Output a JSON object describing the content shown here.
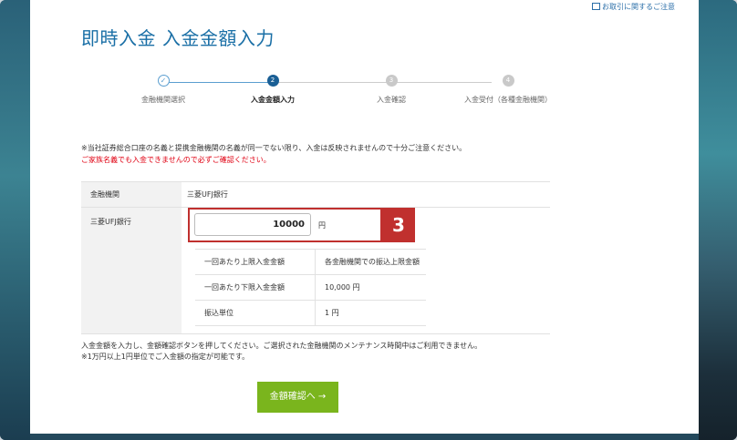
{
  "header": {
    "notice_link": "お取引に関するご注意",
    "title": "即時入金 入金金額入力"
  },
  "steps": [
    {
      "num": "✓",
      "label": "金融機関選択"
    },
    {
      "num": "2",
      "label": "入金金額入力"
    },
    {
      "num": "3",
      "label": "入金確認"
    },
    {
      "num": "4",
      "label": "入金受付（各種金融機関）"
    }
  ],
  "notes": {
    "n1": "※当社証券総合口座の名義と提携金融機関の名義が同一でない限り、入金は反映されませんので十分ご注意ください。",
    "n2": "ご家族名義でも入金できませんので必ずご確認ください。",
    "n3": "入金金額を入力し、金額確認ボタンを押してください。ご選択された金融機関のメンテナンス時間中はご利用できません。",
    "n4": "※1万円以上1円単位でご入金額の指定が可能です。"
  },
  "form": {
    "bank_label": "金融機関",
    "bank_value": "三菱UFJ銀行",
    "amount_label": "三菱UFJ銀行",
    "amount_value": "10000",
    "unit": "円",
    "badge": "3"
  },
  "limits": [
    {
      "k": "一回あたり上限入金金額",
      "v": "各金融機関での振込上限金額"
    },
    {
      "k": "一回あたり下限入金金額",
      "v": "10,000 円"
    },
    {
      "k": "振込単位",
      "v": "1 円"
    }
  ],
  "submit_label": "金額確認へ →",
  "colors": {
    "accent": "#1a6fa6",
    "highlight": "#c0302e",
    "submit": "#7ab51d",
    "warning": "#e00012"
  }
}
